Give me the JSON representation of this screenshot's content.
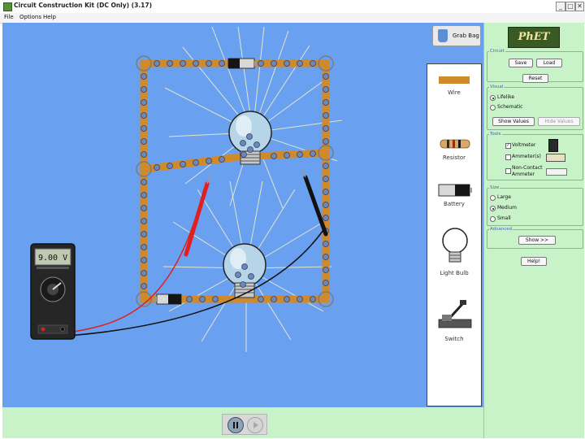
{
  "window": {
    "title": "Circuit Construction Kit (DC Only) (3.17)"
  },
  "menu": [
    "File",
    "Options",
    "Help"
  ],
  "canvas": {
    "background": "#6aa0f0"
  },
  "grab_bag": {
    "label": "Grab Bag"
  },
  "toolbox": {
    "items": [
      "Wire",
      "Resistor",
      "Battery",
      "Light Bulb",
      "Switch"
    ]
  },
  "voltmeter": {
    "reading": "9.00 V"
  },
  "controls": {
    "pause_icon": "pause-icon",
    "step_icon": "step-icon"
  },
  "panel": {
    "logo": "PhET",
    "circuit": {
      "title": "Circuit",
      "save": "Save",
      "load": "Load",
      "reset": "Reset"
    },
    "visual": {
      "title": "Visual",
      "lifelike": "Lifelike",
      "schematic": "Schematic",
      "selected": "Lifelike",
      "show_values": "Show Values",
      "hide_values": "Hide Values"
    },
    "tools": {
      "title": "Tools",
      "voltmeter": "Voltmeter",
      "ammeters": "Ammeter(s)",
      "noncontact_line1": "Non-Contact",
      "noncontact_line2": "Ammeter",
      "voltmeter_checked": true
    },
    "size": {
      "title": "Size",
      "large": "Large",
      "medium": "Medium",
      "small": "Small",
      "selected": "Medium"
    },
    "advanced": {
      "title": "Advanced",
      "show": "Show >>"
    },
    "help": "Help!"
  },
  "colors": {
    "wire": "#d08a2a",
    "panel": "#c8f2c8",
    "electron": "#6f87b8",
    "red_lead": "#e02020",
    "black_lead": "#111111"
  }
}
